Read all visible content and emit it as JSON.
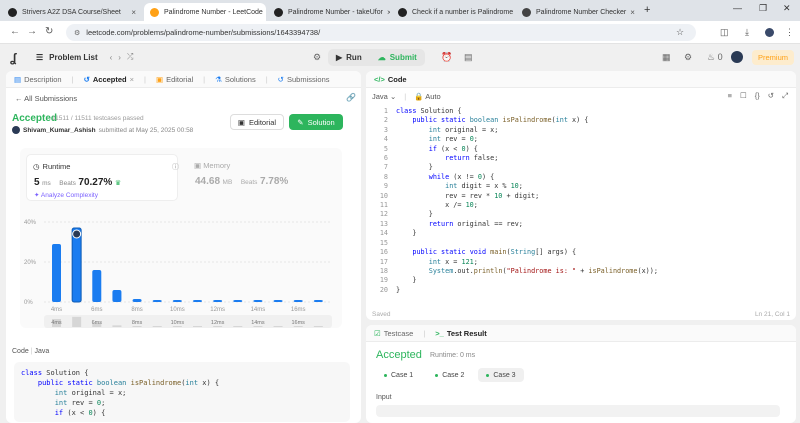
{
  "browser": {
    "tabs": [
      {
        "label": "Strivers A2Z DSA Course/Sheet",
        "active": false
      },
      {
        "label": "Palindrome Number - LeetCode",
        "active": true
      },
      {
        "label": "Palindrome Number - takeUfor",
        "active": false
      },
      {
        "label": "Check if a number is Palindrome",
        "active": false
      },
      {
        "label": "Palindrome Number Checker",
        "active": false
      }
    ],
    "url": "leetcode.com/problems/palindrome-number/submissions/1643394738/"
  },
  "header": {
    "problem_list": "Problem List",
    "run": "Run",
    "submit": "Submit",
    "coins": "0",
    "premium": "Premium"
  },
  "left": {
    "tabs": [
      "Description",
      "Accepted",
      "Editorial",
      "Solutions",
      "Submissions"
    ],
    "all_submissions": "All Submissions",
    "status": "Accepted",
    "testcases": "11511 / 11511 testcases passed",
    "user": "Shivam_Kumar_Ashish",
    "submitted_at": "submitted at May 25, 2025 00:58",
    "editorial_btn": "Editorial",
    "solution_btn": "Solution",
    "runtime": {
      "title": "Runtime",
      "value": "5",
      "unit": "ms",
      "beats_label": "Beats",
      "beats": "70.27%",
      "analyze": "Analyze Complexity"
    },
    "memory": {
      "title": "Memory",
      "value": "44.68",
      "unit": "MB",
      "beats_label": "Beats",
      "beats": "7.78%"
    },
    "code_label": "Code",
    "code_lang": "Java",
    "code_preview": [
      "class Solution {",
      "    public static boolean isPalindrome(int x) {",
      "        int original = x;",
      "        int rev = 0;",
      "        if (x < 0) {"
    ]
  },
  "chart_data": {
    "type": "bar",
    "y_ticks": [
      "40%",
      "20%",
      "0%"
    ],
    "ylim": [
      0,
      40
    ],
    "x_ticks": [
      "4ms",
      "6ms",
      "8ms",
      "10ms",
      "12ms",
      "14ms",
      "16ms"
    ],
    "values": [
      29,
      37,
      16,
      6,
      1.5,
      1,
      1,
      1,
      1,
      1,
      1,
      1,
      1,
      1
    ],
    "highlight_index": 1,
    "accent": "#1a7cf0"
  },
  "right": {
    "tab": "Code",
    "lang": "Java",
    "auto": "Auto",
    "code_lines": [
      "class Solution {",
      "    public static boolean isPalindrome(int x) {",
      "        int original = x;",
      "        int rev = 0;",
      "        if (x < 0) {",
      "            return false;",
      "        }",
      "        while (x != 0) {",
      "            int digit = x % 10;",
      "            rev = rev * 10 + digit;",
      "            x /= 10;",
      "        }",
      "        return original == rev;",
      "    }",
      "",
      "    public static void main(String[] args) {",
      "        int x = 121;",
      "        System.out.println(\"Palindrome is: \" + isPalindrome(x));",
      "    }",
      "}"
    ],
    "saved": "Saved",
    "cursor": "Ln 21, Col 1",
    "bottom_tabs": [
      "Testcase",
      "Test Result"
    ],
    "result": "Accepted",
    "runtime": "Runtime: 0 ms",
    "cases": [
      "Case 1",
      "Case 2",
      "Case 3"
    ],
    "input_label": "Input"
  }
}
